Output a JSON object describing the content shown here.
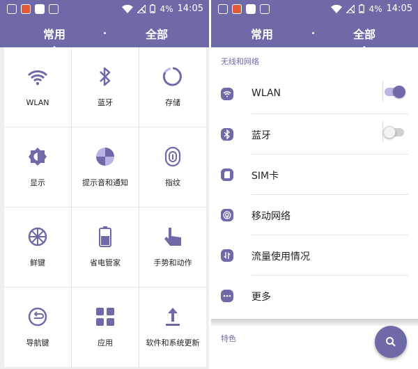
{
  "colors": {
    "accent": "#6e6aa8",
    "accent_light": "#b8b4e4",
    "bg": "#ffffff"
  },
  "status_bar": {
    "battery": "4%",
    "time": "14:05",
    "icons": [
      "notification-icon",
      "app-badge-icon",
      "card-icon",
      "sim-icon",
      "wifi-icon",
      "no-signal-icon",
      "battery-icon"
    ]
  },
  "left_panel": {
    "tabs": [
      {
        "label": "常用",
        "active": true
      },
      {
        "label": "全部",
        "active": false
      }
    ],
    "grid": [
      {
        "label": "WLAN",
        "icon": "wifi-icon"
      },
      {
        "label": "蓝牙",
        "icon": "bluetooth-icon"
      },
      {
        "label": "存储",
        "icon": "storage-icon"
      },
      {
        "label": "显示",
        "icon": "display-icon"
      },
      {
        "label": "提示音和通知",
        "icon": "sound-notification-icon"
      },
      {
        "label": "指纹",
        "icon": "fingerprint-icon"
      },
      {
        "label": "鲜键",
        "icon": "fresh-key-icon"
      },
      {
        "label": "省电管家",
        "icon": "battery-saver-icon"
      },
      {
        "label": "手势和动作",
        "icon": "gesture-icon"
      },
      {
        "label": "导航键",
        "icon": "navigation-key-icon"
      },
      {
        "label": "应用",
        "icon": "apps-icon"
      },
      {
        "label": "软件和系统更新",
        "icon": "system-update-icon"
      }
    ]
  },
  "right_panel": {
    "tabs": [
      {
        "label": "常用",
        "active": false
      },
      {
        "label": "全部",
        "active": true
      }
    ],
    "section_wireless": "无线和网络",
    "rows": [
      {
        "label": "WLAN",
        "icon": "wifi-icon",
        "toggle": "on"
      },
      {
        "label": "蓝牙",
        "icon": "bluetooth-icon",
        "toggle": "off"
      },
      {
        "label": "SIM卡",
        "icon": "sim-card-icon"
      },
      {
        "label": "移动网络",
        "icon": "mobile-network-icon"
      },
      {
        "label": "流量使用情况",
        "icon": "data-usage-icon"
      },
      {
        "label": "更多",
        "icon": "more-icon"
      }
    ],
    "section_featured": "特色",
    "fab_icon": "search-icon"
  }
}
